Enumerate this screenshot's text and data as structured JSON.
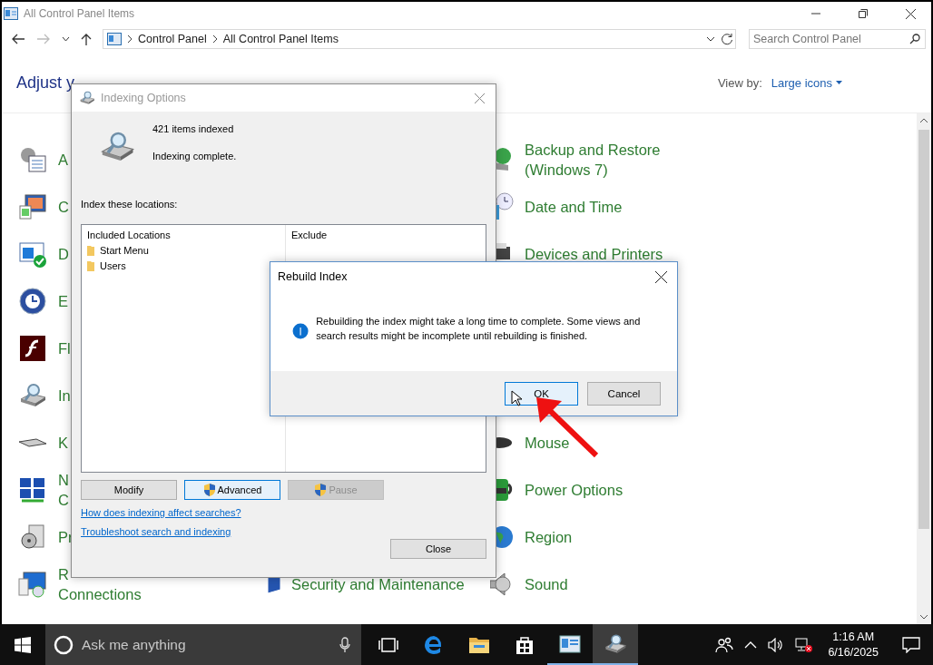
{
  "window": {
    "title": "All Control Panel Items",
    "nav": {
      "back_enabled": true,
      "forward_enabled": false
    },
    "breadcrumb": [
      "Control Panel",
      "All Control Panel Items"
    ],
    "search": {
      "placeholder": "Search Control Panel"
    }
  },
  "header": {
    "title": "Adjust y",
    "view_by_label": "View by:",
    "view_by_value": "Large icons"
  },
  "rows": [
    {
      "left": {
        "lines": [
          "A"
        ]
      },
      "right": {
        "lines": [
          "Backup and Restore",
          "(Windows 7)"
        ]
      }
    },
    {
      "left": {
        "lines": [
          "C"
        ]
      },
      "right": {
        "lines": [
          "Date and Time"
        ]
      }
    },
    {
      "left": {
        "lines": [
          "D"
        ]
      },
      "right": {
        "lines": [
          "Devices and Printers"
        ]
      }
    },
    {
      "left": {
        "lines": [
          "E"
        ]
      }
    },
    {
      "left": {
        "lines": [
          "Fl"
        ]
      }
    },
    {
      "left": {
        "lines": [
          "In"
        ]
      }
    },
    {
      "left": {
        "lines": [
          "K"
        ]
      },
      "right": {
        "lines": [
          "Mouse"
        ]
      }
    },
    {
      "left": {
        "lines": [
          "N",
          "C"
        ]
      },
      "right": {
        "lines": [
          "Power Options"
        ]
      }
    },
    {
      "left": {
        "lines": [
          "Pr"
        ]
      },
      "right": {
        "lines": [
          "Region"
        ]
      }
    },
    {
      "left": {
        "lines": [
          "R",
          "Connections"
        ]
      },
      "middle": {
        "lines": [
          "Security and Maintenance"
        ]
      },
      "right": {
        "lines": [
          "Sound"
        ]
      }
    }
  ],
  "indexing_dialog": {
    "title": "Indexing Options",
    "count": "421 items indexed",
    "status": "Indexing complete.",
    "locations_label": "Index these locations:",
    "columns": [
      "Included Locations",
      "Exclude"
    ],
    "locations": [
      "Start Menu",
      "Users"
    ],
    "buttons": [
      {
        "label": "Modify",
        "shield": false,
        "focused": false,
        "disabled": false
      },
      {
        "label": "Advanced",
        "shield": true,
        "focused": true,
        "disabled": false
      },
      {
        "label": "Pause",
        "shield": true,
        "focused": false,
        "disabled": true
      }
    ],
    "links": [
      "How does indexing affect searches?",
      "Troubleshoot search and indexing"
    ],
    "close_button": "Close"
  },
  "rebuild_dialog": {
    "title": "Rebuild Index",
    "message": "Rebuilding the index might take a long time to complete. Some views and search results might be incomplete until rebuilding is finished.",
    "buttons": [
      {
        "label": "OK",
        "default": true
      },
      {
        "label": "Cancel",
        "default": false
      }
    ]
  },
  "taskbar": {
    "search_placeholder": "Ask me anything",
    "apps": [
      {
        "kind": "task-view",
        "open": false,
        "selected": false
      },
      {
        "kind": "edge",
        "open": false,
        "selected": false
      },
      {
        "kind": "explorer",
        "open": false,
        "selected": false
      },
      {
        "kind": "store",
        "open": false,
        "selected": false
      },
      {
        "kind": "control-panel",
        "open": true,
        "selected": false
      },
      {
        "kind": "indexing",
        "open": true,
        "selected": true
      }
    ],
    "time": "1:16 AM",
    "date": "6/16/2025"
  }
}
